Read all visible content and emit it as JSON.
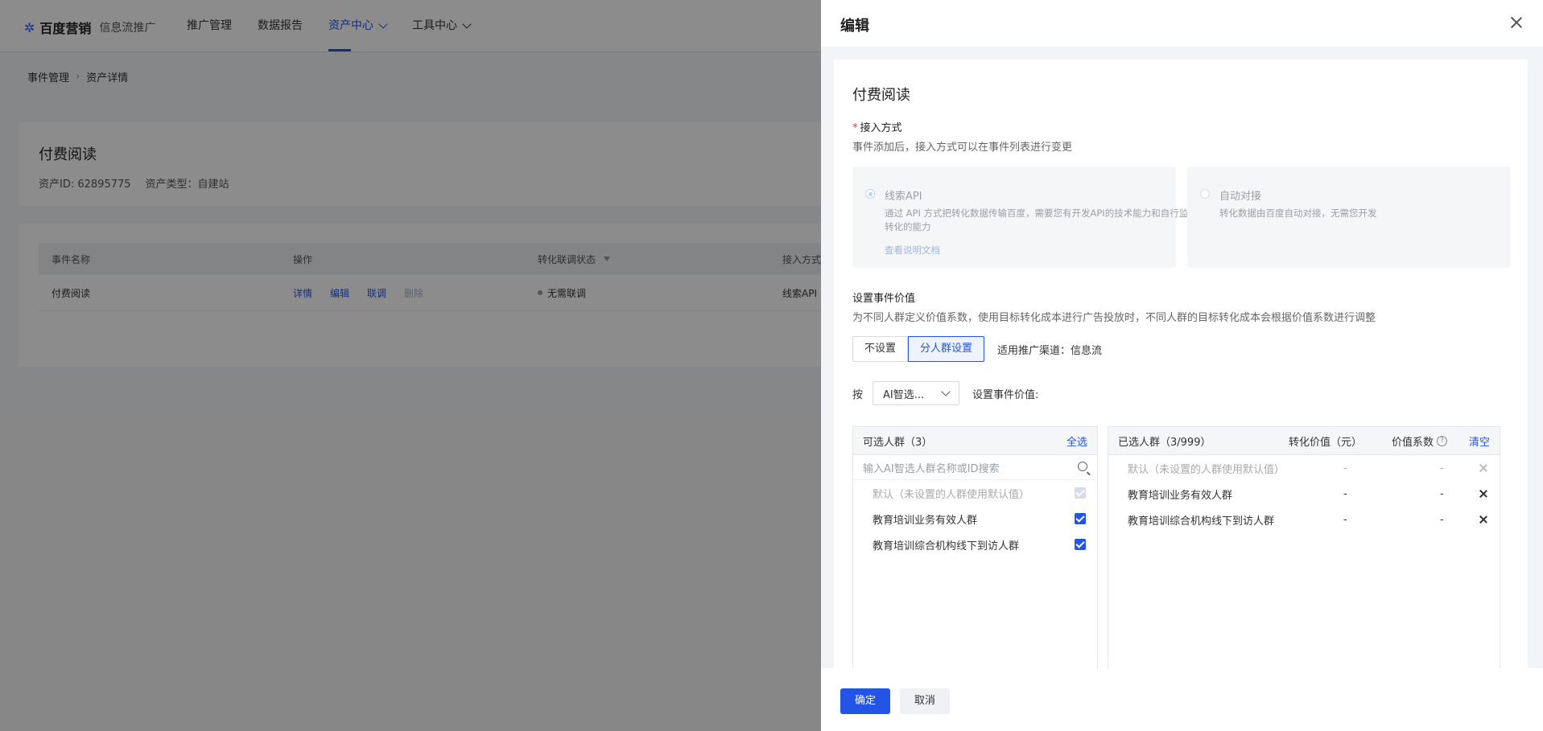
{
  "topbar": {
    "brand": "百度营销",
    "product": "信息流推广",
    "nav": [
      "推广管理",
      "数据报告",
      "资产中心",
      "工具中心"
    ]
  },
  "breadcrumb": [
    "事件管理",
    "资产详情"
  ],
  "asset": {
    "title": "付费阅读",
    "id_text": "资产ID: 62895775",
    "type_text": "资产类型：自建站"
  },
  "events_table": {
    "headers": [
      "事件名称",
      "操作",
      "转化联调状态",
      "接入方式"
    ],
    "row": {
      "name": "付费阅读",
      "actions": [
        "详情",
        "编辑",
        "联调",
        "删除"
      ],
      "status": "无需联调",
      "access": "线索API"
    }
  },
  "drawer": {
    "title": "编辑",
    "section_title": "付费阅读",
    "access_label": "接入方式",
    "access_hint": "事件添加后，接入方式可以在事件列表进行变更",
    "option_api": {
      "title": "线索API",
      "desc": "通过 API 方式把转化数据传输百度，需要您有开发API的技术能力和自行监控转化的能力",
      "link": "查看说明文档"
    },
    "option_auto": {
      "title": "自动对接",
      "desc": "转化数据由百度自动对接，无需您开发"
    },
    "value_label": "设置事件价值",
    "value_hint": "为不同人群定义价值系数，使用目标转化成本进行广告投放时，不同人群的目标转化成本会根据价值系数进行调整",
    "seg_options": [
      "不设置",
      "分人群设置"
    ],
    "channel_text": "适用推广渠道：信息流",
    "by_label": "按",
    "select_value": "AI智选...",
    "set_value_label": "设置事件价值:",
    "left": {
      "title": "可选人群（3）",
      "select_all": "全选",
      "search_placeholder": "输入AI智选人群名称或ID搜索",
      "items": [
        "默认（未设置的人群使用默认值）",
        "教育培训业务有效人群",
        "教育培训综合机构线下到访人群"
      ]
    },
    "right": {
      "title": "已选人群（3/999）",
      "col_value": "转化价值（元）",
      "col_coef": "价值系数",
      "clear": "清空",
      "items": [
        {
          "name": "默认（未设置的人群使用默认值）",
          "value": "-",
          "coef": "-"
        },
        {
          "name": "教育培训业务有效人群",
          "value": "-",
          "coef": "-"
        },
        {
          "name": "教育培训综合机构线下到访人群",
          "value": "-",
          "coef": "-"
        }
      ]
    },
    "ok_label": "确定",
    "cancel_label": "取消"
  }
}
